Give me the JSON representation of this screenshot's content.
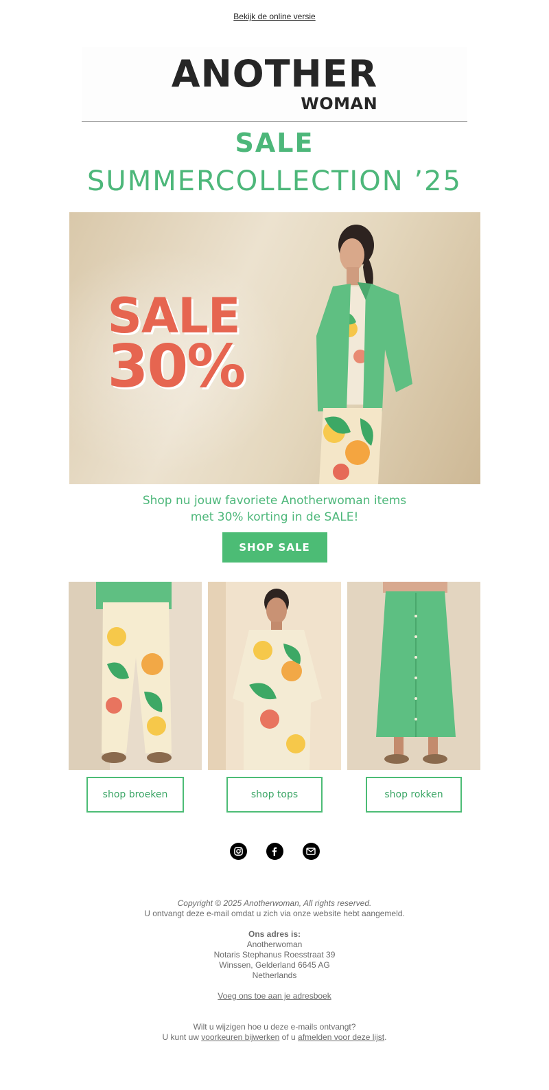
{
  "header": {
    "view_online": "Bekijk de online versie"
  },
  "logo": {
    "line1": "ANOTHER",
    "line2": "WOMAN"
  },
  "headline": {
    "sale": "SALE",
    "collection": "SUMMERCOLLECTION ’25"
  },
  "hero": {
    "sale_text": "SALE",
    "percent_text": "30%"
  },
  "promo": {
    "line1": "Shop nu jouw favoriete Anotherwoman items",
    "line2": "met 30% korting in de SALE!",
    "button": "SHOP SALE"
  },
  "products": [
    {
      "button": "shop broeken"
    },
    {
      "button": "shop tops"
    },
    {
      "button": "shop rokken"
    }
  ],
  "social": [
    {
      "icon": "instagram-icon"
    },
    {
      "icon": "facebook-icon"
    },
    {
      "icon": "email-icon"
    }
  ],
  "footer": {
    "copyright": "Copyright © 2025 Anotherwoman, All rights reserved.",
    "reason": "U ontvangt deze e-mail omdat u zich via onze website hebt aangemeld.",
    "address_label": "Ons adres is:",
    "address_name": "Anotherwoman",
    "address_street": "Notaris Stephanus Roesstraat 39",
    "address_city": "Winssen, Gelderland 6645 AG",
    "address_country": "Netherlands",
    "addressbook_link": "Voeg ons toe aan je adresboek",
    "change_question": "Wilt u wijzigen hoe u deze e-mails ontvangt?",
    "prefix": "U kunt uw",
    "preferences_link": "voorkeuren bijwerken",
    "middle": "of u",
    "unsubscribe_link": "afmelden voor deze lijst",
    "end": "."
  },
  "colors": {
    "brand_green": "#4cbc75",
    "sale_red": "#e66550"
  }
}
